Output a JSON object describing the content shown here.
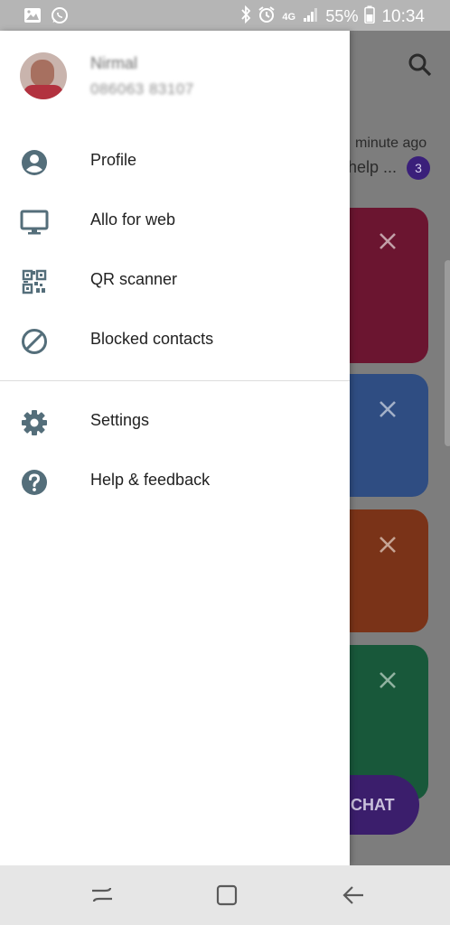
{
  "status_bar": {
    "icons_left": [
      "gallery-icon",
      "whatsapp-icon"
    ],
    "icons_right": [
      "bluetooth-icon",
      "alarm-icon",
      "4g-icon",
      "signal-icon"
    ],
    "network": "4G",
    "battery": "55%",
    "time": "10:34"
  },
  "background": {
    "time_text": "minute ago",
    "preview_text": "help ...",
    "unread_count": "3",
    "fab_label": "CHAT",
    "card_colors": [
      "#6b1530",
      "#2f4d82",
      "#7a3318",
      "#18583a"
    ]
  },
  "account": {
    "name": "Nirmal",
    "phone": "086063 83107"
  },
  "menu": {
    "items": [
      {
        "label": "Profile",
        "icon": "account-circle-icon"
      },
      {
        "label": "Allo for web",
        "icon": "monitor-icon"
      },
      {
        "label": "QR scanner",
        "icon": "qr-code-icon"
      },
      {
        "label": "Blocked contacts",
        "icon": "block-icon"
      },
      {
        "label": "Settings",
        "icon": "gear-icon"
      },
      {
        "label": "Help & feedback",
        "icon": "help-icon"
      }
    ]
  },
  "colors": {
    "icon": "#546e7a",
    "accent_purple": "#3b1e6c"
  },
  "nav_bar": {
    "buttons": [
      "recents-button",
      "home-button",
      "back-button"
    ]
  }
}
